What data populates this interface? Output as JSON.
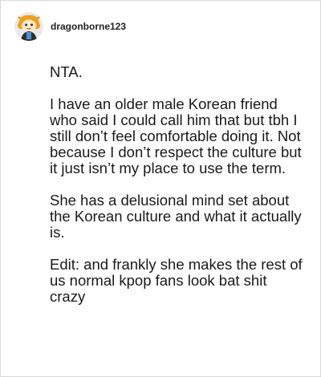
{
  "post": {
    "username": "dragonborne123",
    "avatar_icon": "dragon-avatar-icon",
    "paragraphs": [
      "NTA.",
      "I have an older male Korean friend who said I could call him that but tbh I still don’t feel comfortable doing it. Not because I don’t respect the culture but it just isn’t my place to use the term.",
      "She has a delusional mind set about the Korean culture and what it actually is.",
      "Edit: and frankly she makes the rest of us normal kpop fans look bat shit crazy"
    ]
  }
}
